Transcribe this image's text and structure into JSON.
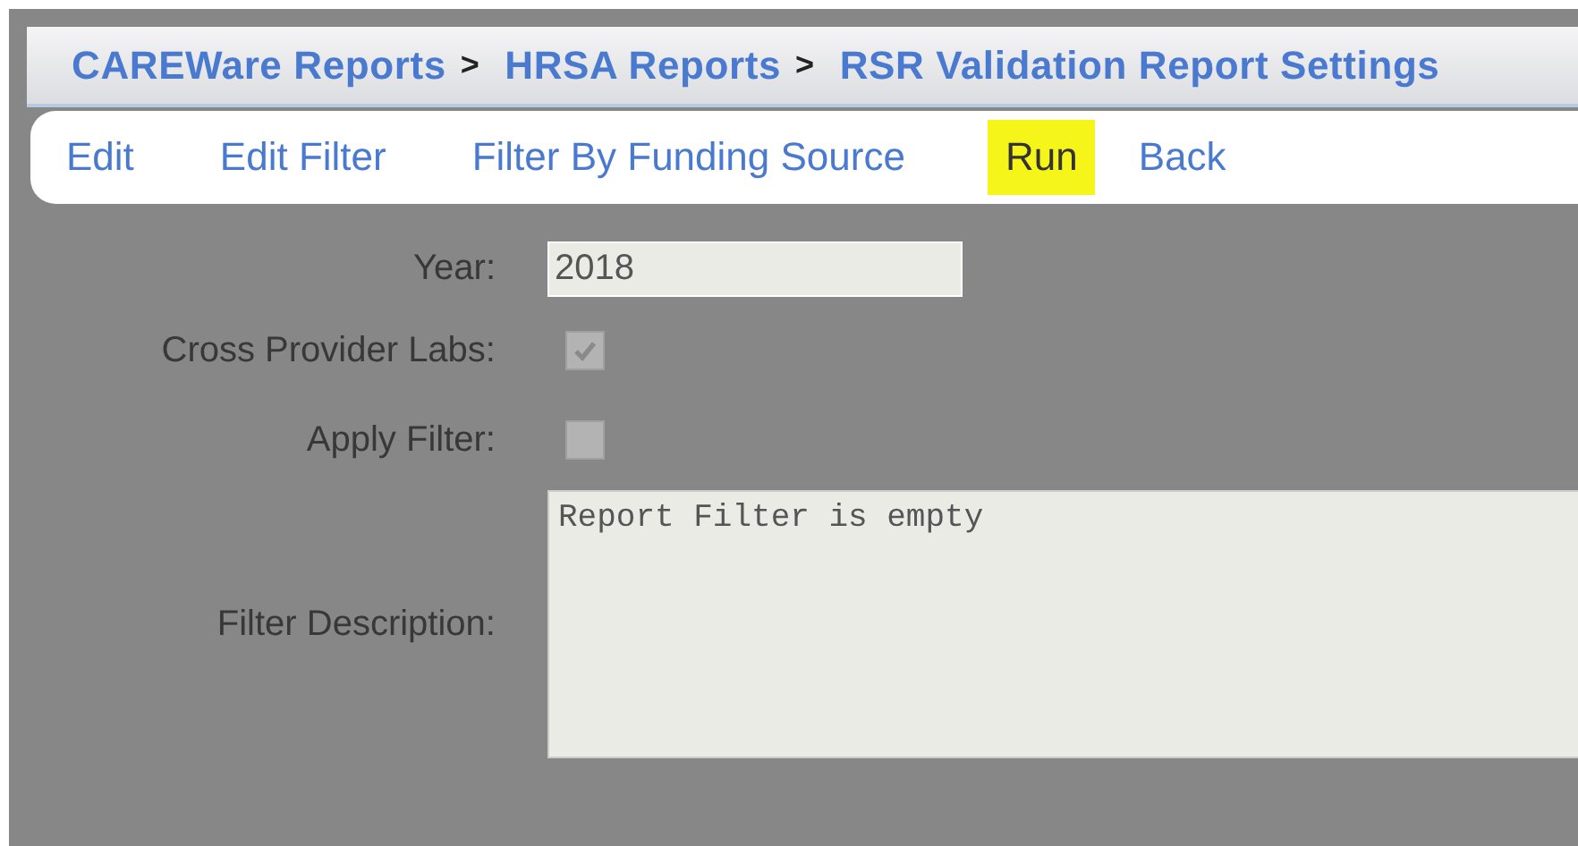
{
  "breadcrumb": [
    {
      "label": "CAREWare Reports",
      "separator": ">"
    },
    {
      "label": "HRSA Reports",
      "separator": ">"
    },
    {
      "label": "RSR Validation Report Settings"
    }
  ],
  "menu": [
    {
      "label": "Edit",
      "highlighted": false
    },
    {
      "label": "Edit Filter",
      "highlighted": false
    },
    {
      "label": "Filter By Funding Source",
      "highlighted": false
    },
    {
      "label": "Run",
      "highlighted": true
    },
    {
      "label": "Back",
      "highlighted": false
    }
  ],
  "fields": [
    {
      "kind": "text",
      "label": "Year:",
      "value": "2018"
    },
    {
      "kind": "checkbox",
      "label": "Cross Provider Labs:",
      "checked": true,
      "disabled": true
    },
    {
      "kind": "checkbox",
      "label": "Apply Filter:",
      "checked": false,
      "disabled": true
    },
    {
      "kind": "textarea",
      "label": "Filter Description:",
      "value": "Report Filter is empty"
    }
  ]
}
